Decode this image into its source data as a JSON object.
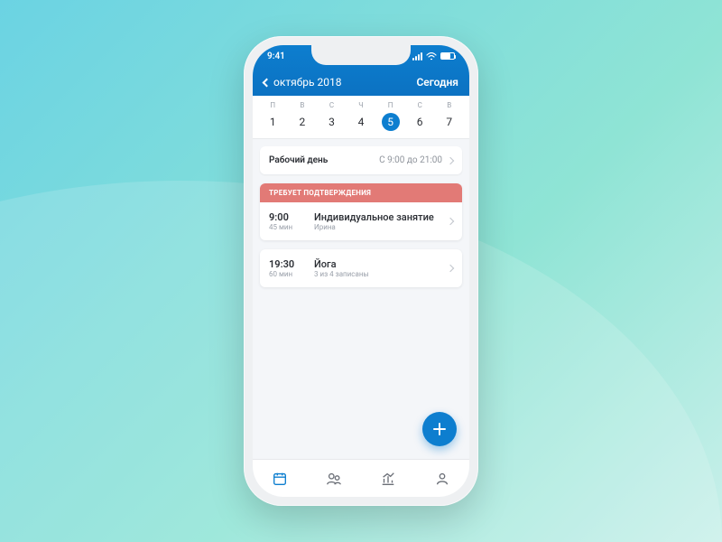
{
  "status": {
    "time": "9:41"
  },
  "header": {
    "month": "октябрь 2018",
    "today": "Сегодня"
  },
  "week": {
    "headers": [
      "П",
      "В",
      "С",
      "Ч",
      "П",
      "С",
      "В"
    ],
    "days": [
      "1",
      "2",
      "3",
      "4",
      "5",
      "6",
      "7"
    ],
    "selected_index": 4,
    "dot_index": 2
  },
  "worktime": {
    "label": "Рабочий день",
    "value": "С 9:00 до 21:00"
  },
  "banner": "ТРЕБУЕТ ПОДТВЕРЖДЕНИЯ",
  "events": [
    {
      "time": "9:00",
      "duration": "45 мин",
      "title": "Индивидуальное занятие",
      "sub": "Ирина"
    },
    {
      "time": "19:30",
      "duration": "60 мин",
      "title": "Йога",
      "sub": "3 из 4 записаны"
    }
  ],
  "colors": {
    "accent": "#0d7ecf",
    "banner": "#e27a76"
  }
}
